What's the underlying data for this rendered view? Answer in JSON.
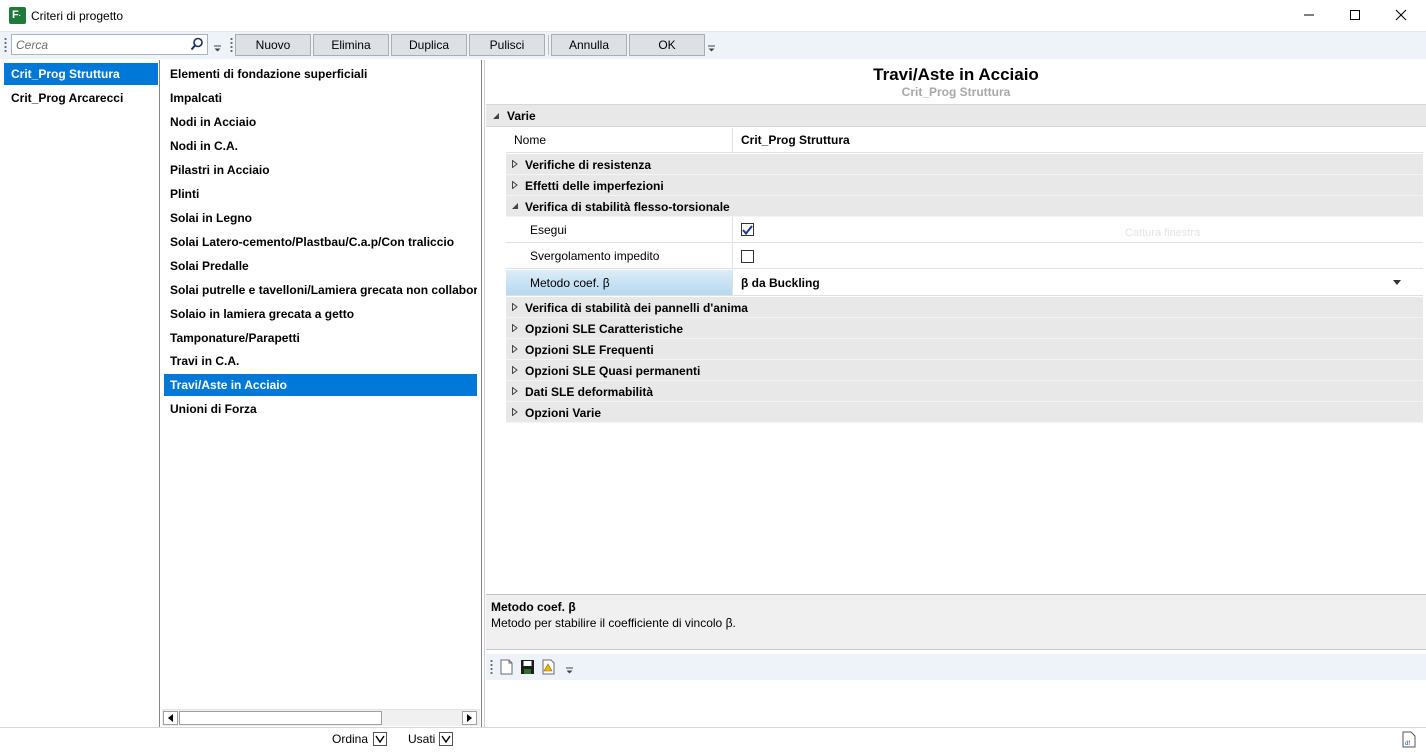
{
  "window": {
    "title": "Criteri di progetto",
    "minimize_icon": "minimize-icon",
    "maximize_icon": "maximize-icon",
    "close_icon": "close-icon"
  },
  "toolbar": {
    "search_placeholder": "Cerca",
    "buttons": {
      "nuovo": "Nuovo",
      "elimina": "Elimina",
      "duplica": "Duplica",
      "pulisci": "Pulisci",
      "annulla": "Annulla",
      "ok": "OK"
    }
  },
  "criteria_list": {
    "items": [
      {
        "label": "Crit_Prog Struttura",
        "selected": true
      },
      {
        "label": "Crit_Prog Arcarecci",
        "selected": false
      }
    ]
  },
  "element_list": {
    "items": [
      {
        "label": "Elementi di fondazione superficiali"
      },
      {
        "label": "Impalcati"
      },
      {
        "label": "Nodi in Acciaio"
      },
      {
        "label": "Nodi in C.A."
      },
      {
        "label": "Pilastri in Acciaio"
      },
      {
        "label": "Plinti"
      },
      {
        "label": "Solai in Legno"
      },
      {
        "label": "Solai Latero-cemento/Plastbau/C.a.p/Con traliccio"
      },
      {
        "label": "Solai Predalle"
      },
      {
        "label": "Solai putrelle e tavelloni/Lamiera grecata non collaborante"
      },
      {
        "label": "Solaio in lamiera grecata a getto"
      },
      {
        "label": "Tamponature/Parapetti"
      },
      {
        "label": "Travi in C.A."
      },
      {
        "label": "Travi/Aste in Acciaio",
        "selected": true
      },
      {
        "label": "Unioni di Forza"
      }
    ]
  },
  "header": {
    "title": "Travi/Aste in Acciaio",
    "subtitle": "Crit_Prog Struttura"
  },
  "property_grid": {
    "category": "Varie",
    "nome_label": "Nome",
    "nome_value": "Crit_Prog Struttura",
    "sections": {
      "verifiche_resistenza": "Verifiche di resistenza",
      "effetti_imperfezioni": "Effetti delle imperfezioni",
      "stabilita_flesso": "Verifica di stabilità flesso-torsionale",
      "stabilita_pannelli": "Verifica di stabilità dei pannelli d'anima",
      "sle_caratteristiche": "Opzioni SLE Caratteristiche",
      "sle_frequenti": "Opzioni SLE Frequenti",
      "sle_quasi_permanenti": "Opzioni SLE Quasi permanenti",
      "sle_deformabilita": "Dati SLE deformabilità",
      "opzioni_varie": "Opzioni Varie"
    },
    "esegui_label": "Esegui",
    "esegui_checked": true,
    "svergolamento_label": "Svergolamento impedito",
    "svergolamento_checked": false,
    "metodo_label": "Metodo coef. β",
    "metodo_value": "β da Buckling",
    "ghost_text": "Cattura finestra"
  },
  "description": {
    "title": "Metodo coef. β",
    "text": "Metodo per stabilire il coefficiente di vincolo β."
  },
  "statusbar": {
    "ordina": "Ordina",
    "usati": "Usati"
  }
}
